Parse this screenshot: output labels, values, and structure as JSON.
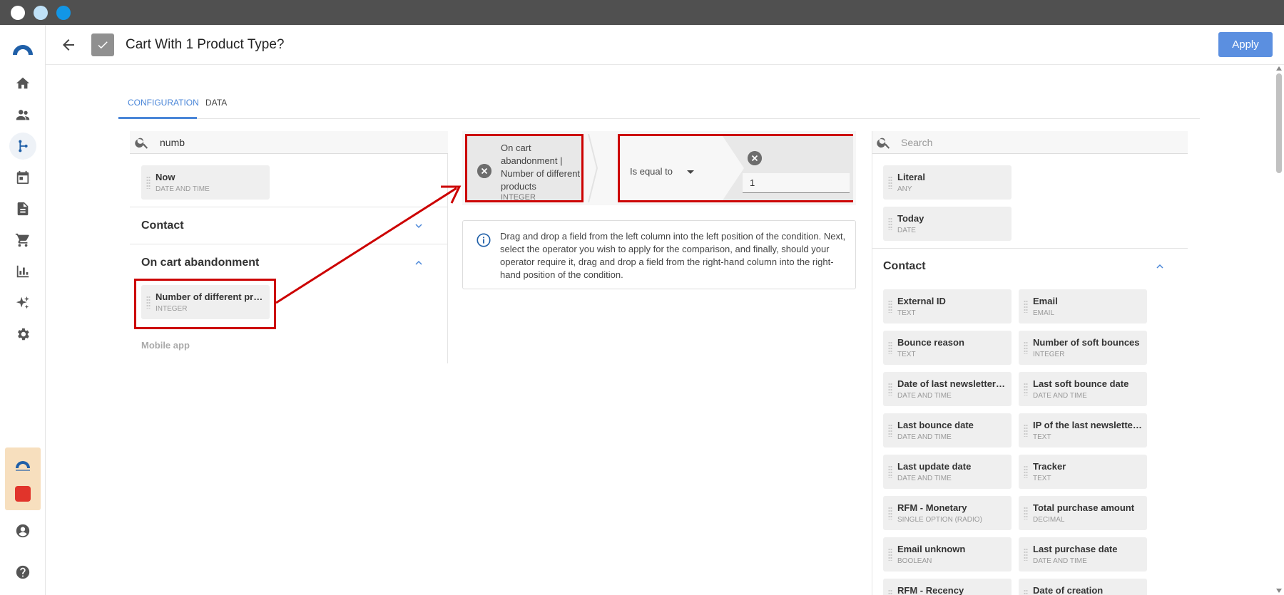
{
  "header": {
    "title": "Cart With 1 Product Type?",
    "apply_label": "Apply"
  },
  "tabs": [
    {
      "label": "CONFIGURATION",
      "active": true
    },
    {
      "label": "DATA",
      "active": false
    }
  ],
  "left_panel": {
    "search_value": "numb",
    "top_fields": [
      {
        "name": "Now",
        "type": "DATE AND TIME"
      }
    ],
    "sections": [
      {
        "title": "Contact",
        "expanded": false
      },
      {
        "title": "On cart abandonment",
        "expanded": true,
        "fields": [
          {
            "name": "Number of different products",
            "type": "INTEGER"
          }
        ]
      }
    ],
    "mobile_app_label": "Mobile app"
  },
  "condition": {
    "left_field": "On cart abandonment | Number of different products",
    "left_type": "INTEGER",
    "operator": "Is equal to",
    "value": "1"
  },
  "info": {
    "text": "Drag and drop a field from the left column into the left position of the condition. Next, select the operator you wish to apply for the comparison, and finally, should your operator require it, drag and drop a field from the right-hand column into the right-hand position of the condition."
  },
  "right_panel": {
    "search_placeholder": "Search",
    "top_fields": [
      {
        "name": "Literal",
        "type": "ANY"
      },
      {
        "name": "Today",
        "type": "DATE"
      }
    ],
    "section_title": "Contact",
    "fields": [
      {
        "name": "External ID",
        "type": "TEXT"
      },
      {
        "name": "Email",
        "type": "EMAIL"
      },
      {
        "name": "Bounce reason",
        "type": "TEXT"
      },
      {
        "name": "Number of soft bounces",
        "type": "INTEGER"
      },
      {
        "name": "Date of last newsletter reading",
        "type": "DATE AND TIME"
      },
      {
        "name": "Last soft bounce date",
        "type": "DATE AND TIME"
      },
      {
        "name": "Last bounce date",
        "type": "DATE AND TIME"
      },
      {
        "name": "IP of the last newsletter reading",
        "type": "TEXT"
      },
      {
        "name": "Last update date",
        "type": "DATE AND TIME"
      },
      {
        "name": "Tracker",
        "type": "TEXT"
      },
      {
        "name": "RFM - Monetary",
        "type": "SINGLE OPTION (RADIO)"
      },
      {
        "name": "Total purchase amount",
        "type": "DECIMAL"
      },
      {
        "name": "Email unknown",
        "type": "BOOLEAN"
      },
      {
        "name": "Last purchase date",
        "type": "DATE AND TIME"
      },
      {
        "name": "RFM - Recency",
        "type": ""
      },
      {
        "name": "Date of creation",
        "type": ""
      }
    ]
  },
  "colors": {
    "accent": "#4a86d8",
    "apply_button": "#5b8fe0",
    "annotation": "#cc0000",
    "titlebar": "#505050"
  },
  "icons": {
    "sidebar": [
      "home-icon",
      "contacts-icon",
      "workflow-icon",
      "calendar-icon",
      "document-icon",
      "cart-icon",
      "chart-icon",
      "sparkle-icon",
      "gear-icon",
      "account-icon",
      "help-icon"
    ]
  }
}
